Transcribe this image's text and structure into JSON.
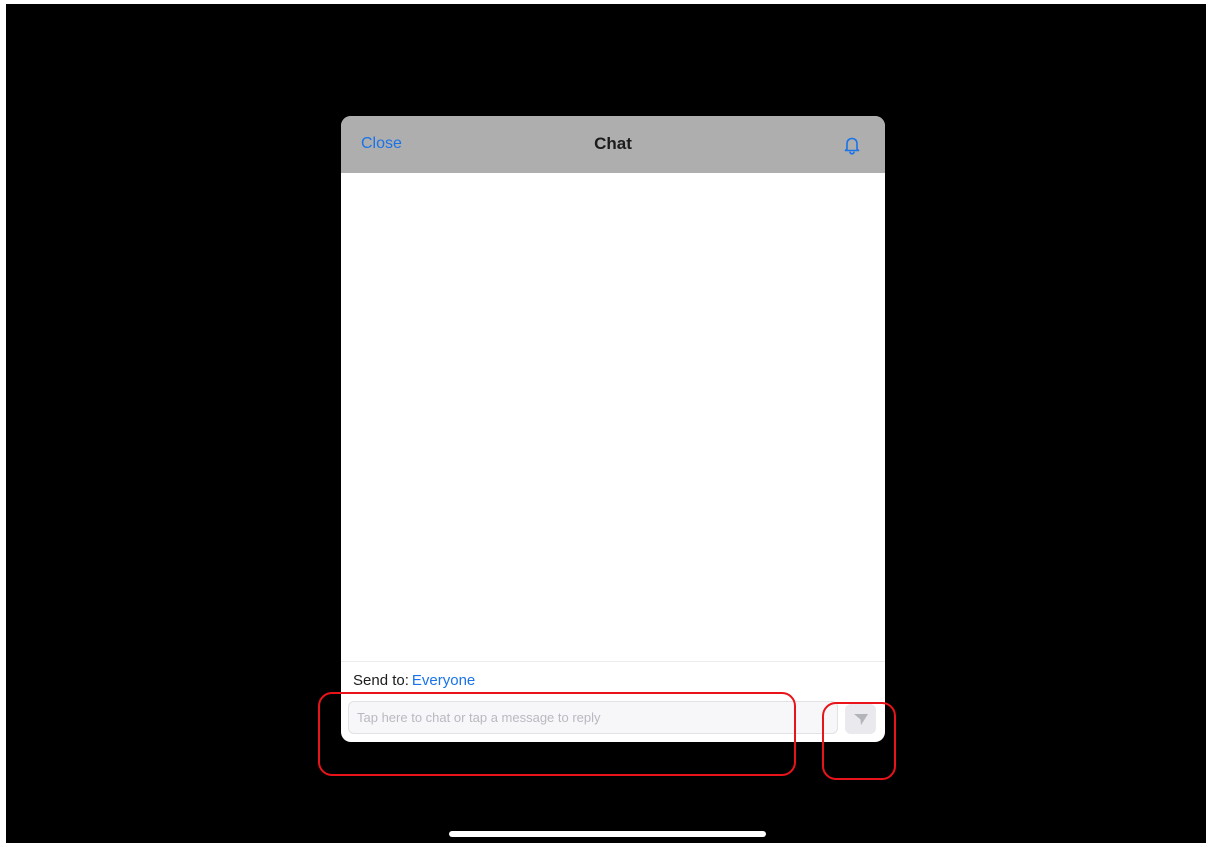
{
  "header": {
    "close_label": "Close",
    "title": "Chat",
    "bell_icon": "bell-icon"
  },
  "send_to": {
    "label": "Send to:",
    "recipient": "Everyone"
  },
  "composer": {
    "placeholder": "Tap here to chat or tap a message to reply",
    "value": "",
    "send_icon": "send-icon"
  },
  "colors": {
    "accent": "#1a73e8",
    "header_bg": "#aeaeae",
    "highlight": "#e8141a",
    "background": "#000000"
  }
}
